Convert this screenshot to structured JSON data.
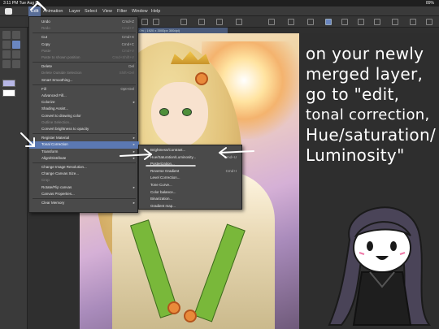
{
  "status_bar": {
    "time": "3:11 PM",
    "date": "Tue Aug 8",
    "battery": "89%"
  },
  "menu": {
    "items": [
      "Edit",
      "Animation",
      "Layer",
      "Select",
      "View",
      "Filter",
      "Window",
      "Help"
    ],
    "active": "Edit"
  },
  "canvas": {
    "tab_label": "* (0.0% | 1920 x 3000px 300dpi)"
  },
  "edit_menu": {
    "items": [
      {
        "label": "Undo",
        "shortcut": "Cmd+Z",
        "disabled": false
      },
      {
        "label": "Redo",
        "shortcut": "Cmd+Y",
        "disabled": true
      },
      {
        "sep": true
      },
      {
        "label": "Cut",
        "shortcut": "Cmd+X",
        "disabled": false
      },
      {
        "label": "Copy",
        "shortcut": "Cmd+C",
        "disabled": false
      },
      {
        "label": "Paste",
        "shortcut": "Cmd+V",
        "disabled": true
      },
      {
        "label": "Paste to shown position",
        "shortcut": "Cmd+Shift+V",
        "disabled": true
      },
      {
        "sep": true
      },
      {
        "label": "Delete",
        "shortcut": "Del",
        "disabled": false
      },
      {
        "label": "Delete Outside Selection",
        "shortcut": "Shift+Del",
        "disabled": true
      },
      {
        "label": "Smart Smoothing...",
        "shortcut": "",
        "disabled": false
      },
      {
        "sep": true
      },
      {
        "label": "Fill",
        "shortcut": "Opt+Del",
        "disabled": false
      },
      {
        "label": "Advanced Fill...",
        "shortcut": "",
        "disabled": false
      },
      {
        "label": "Colorize",
        "shortcut": "",
        "disabled": false,
        "submenu": true
      },
      {
        "label": "Shading Assist...",
        "shortcut": "",
        "disabled": false
      },
      {
        "label": "Convert to drawing color",
        "shortcut": "",
        "disabled": false
      },
      {
        "label": "Outline Selection...",
        "shortcut": "",
        "disabled": true
      },
      {
        "label": "Convert brightness to opacity",
        "shortcut": "",
        "disabled": false
      },
      {
        "sep": true
      },
      {
        "label": "Register Material",
        "shortcut": "",
        "disabled": false,
        "submenu": true
      },
      {
        "label": "Tonal Correction",
        "shortcut": "",
        "disabled": false,
        "submenu": true,
        "highlight": true
      },
      {
        "label": "Transform",
        "shortcut": "",
        "disabled": false,
        "submenu": true
      },
      {
        "label": "Align/Distribute",
        "shortcut": "",
        "disabled": false,
        "submenu": true
      },
      {
        "sep": true
      },
      {
        "label": "Change Image Resolution...",
        "shortcut": "",
        "disabled": false
      },
      {
        "label": "Change Canvas Size...",
        "shortcut": "",
        "disabled": false
      },
      {
        "label": "Crop",
        "shortcut": "",
        "disabled": true
      },
      {
        "label": "Rotate/Flip canvas",
        "shortcut": "",
        "disabled": false,
        "submenu": true
      },
      {
        "label": "Canvas Properties...",
        "shortcut": "",
        "disabled": false
      },
      {
        "sep": true
      },
      {
        "label": "Clear Memory",
        "shortcut": "",
        "disabled": false,
        "submenu": true
      }
    ]
  },
  "tonal_submenu": {
    "items": [
      {
        "label": "Brightness/Contrast...",
        "shortcut": ""
      },
      {
        "label": "Hue/Saturation/Luminosity...",
        "shortcut": "Cmd+U"
      },
      {
        "label": "Posterization...",
        "shortcut": ""
      },
      {
        "label": "Reverse Gradient",
        "shortcut": "Cmd+I"
      },
      {
        "label": "Level Correction...",
        "shortcut": ""
      },
      {
        "label": "Tone Curve...",
        "shortcut": ""
      },
      {
        "label": "Color balance...",
        "shortcut": ""
      },
      {
        "label": "Binarization...",
        "shortcut": ""
      },
      {
        "label": "Gradient map...",
        "shortcut": ""
      }
    ]
  },
  "annotation": {
    "lines": [
      "on your newly",
      "merged layer,",
      "go to \"edit,",
      "tonal correction,",
      "Hue/saturation/",
      "Luminosity\""
    ]
  },
  "colors": {
    "accent": "#5b78b2",
    "menu_bg": "#4a4a4a",
    "app_bg": "#2f2f2f"
  }
}
